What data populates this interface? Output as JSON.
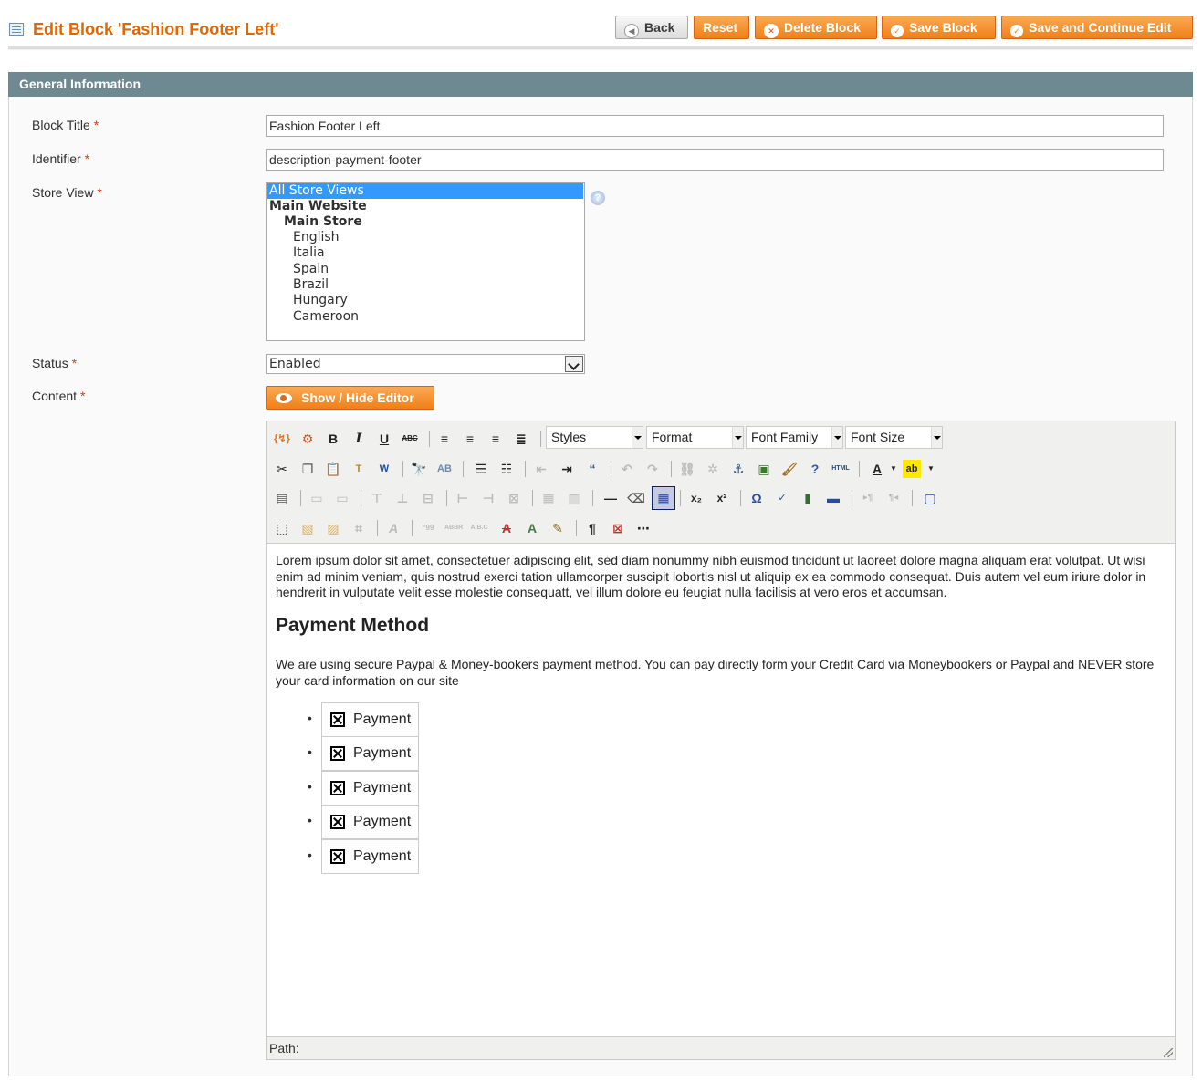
{
  "header": {
    "title": "Edit Block 'Fashion Footer Left'",
    "buttons": {
      "back": "Back",
      "reset": "Reset",
      "delete": "Delete Block",
      "save": "Save Block",
      "save_continue": "Save and Continue Edit"
    }
  },
  "section": {
    "title": "General Information"
  },
  "form": {
    "block_title": {
      "label": "Block Title",
      "value": "Fashion Footer Left"
    },
    "identifier": {
      "label": "Identifier",
      "value": "description-payment-footer"
    },
    "store_view": {
      "label": "Store View",
      "options": [
        "All Store Views",
        "Main Website",
        "Main Store",
        "English",
        "Italia",
        "Spain",
        "Brazil",
        "Hungary",
        "Cameroon"
      ],
      "selected": "All Store Views"
    },
    "status": {
      "label": "Status",
      "value": "Enabled"
    },
    "content": {
      "label": "Content"
    },
    "required_mark": "*",
    "show_hide_editor": "Show / Hide Editor",
    "help_glyph": "?"
  },
  "editor": {
    "dropdowns": {
      "styles": "Styles",
      "format": "Format",
      "font_family": "Font Family",
      "font_size": "Font Size"
    },
    "paragraph1": "Lorem ipsum dolor sit amet, consectetuer adipiscing elit, sed diam nonummy nibh euismod tincidunt ut laoreet dolore magna aliquam erat volutpat. Ut wisi enim ad minim veniam, quis nostrud exerci tation ullamcorper suscipit lobortis nisl ut aliquip ex ea commodo consequat. Duis autem vel eum iriure dolor in hendrerit in vulputate velit esse molestie consequatt, vel illum dolore eu feugiat nulla facilisis at vero eros et accumsan.",
    "heading": "Payment Method",
    "paragraph2": "We are using secure Paypal & Money-bookers payment method. You can pay directly form your Credit Card via Moneybookers or Paypal and NEVER store your card information on our site",
    "list_items": [
      "Payment",
      "Payment",
      "Payment",
      "Payment",
      "Payment"
    ],
    "bullet": "•",
    "path_label": "Path:"
  }
}
